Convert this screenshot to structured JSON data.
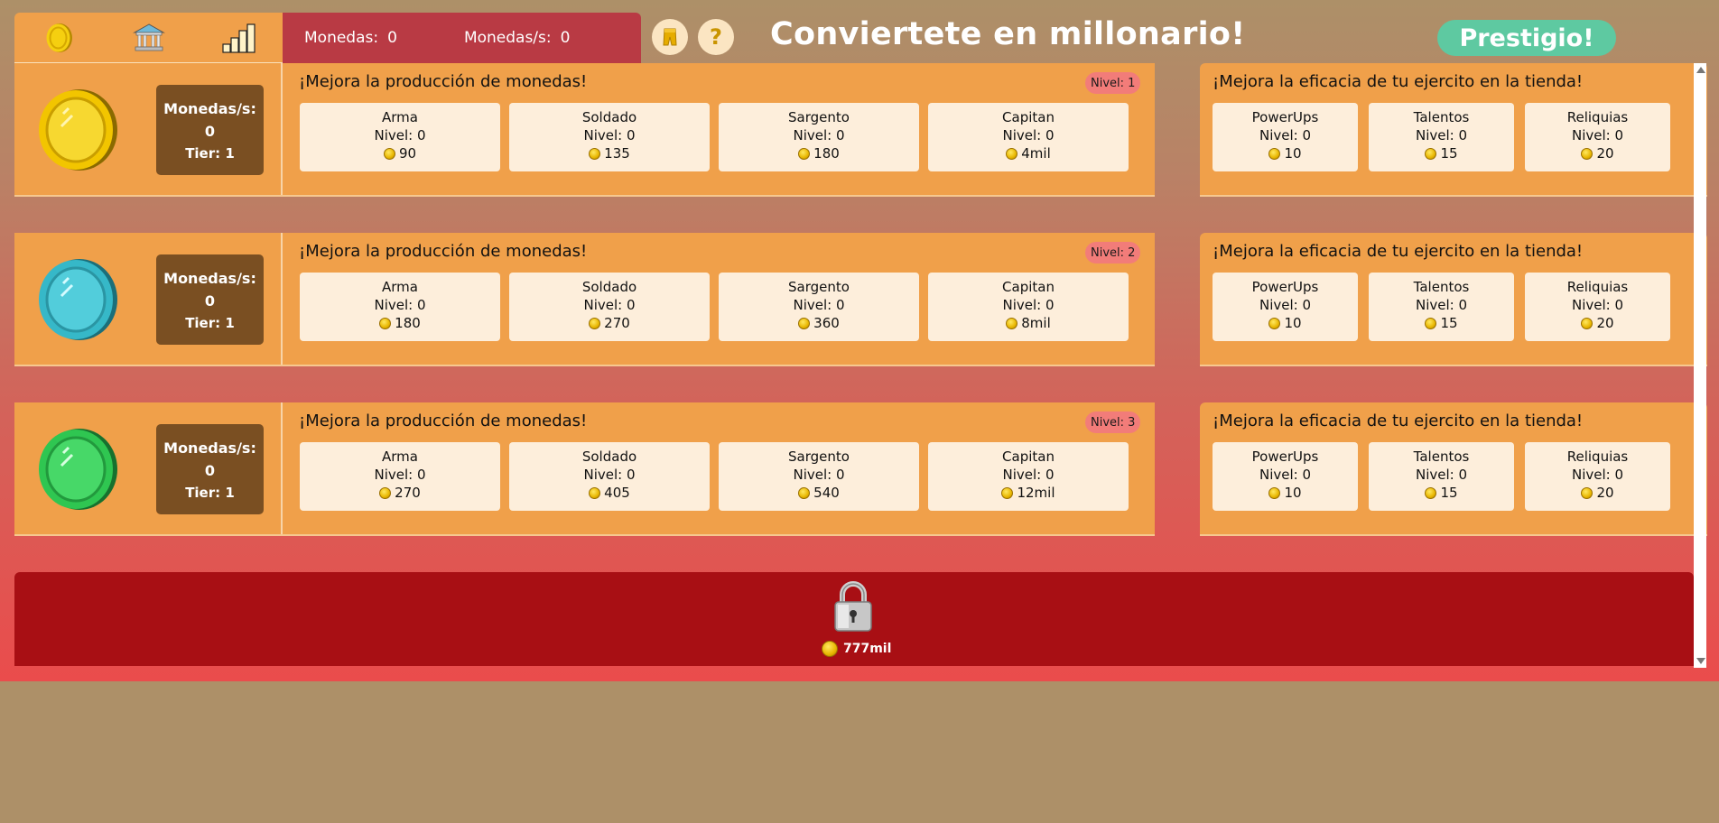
{
  "header": {
    "nav": [
      "coin-icon",
      "bank-icon",
      "bar-chart-icon"
    ],
    "coins_label": "Monedas:",
    "coins_value": "0",
    "rate_label": "Monedas/s:",
    "rate_value": "0",
    "help_symbol": "?",
    "title": "Conviertete en millonario!",
    "prestige_label": "Prestigio!"
  },
  "rows": [
    {
      "coin_color": "#f2c500",
      "rate_label": "Monedas/s:",
      "rate_value": "0",
      "tier": "Tier: 1",
      "upgrade_title": "¡Mejora la producción de monedas!",
      "level": "Nivel: 1",
      "upgrades": [
        {
          "name": "Arma",
          "level": "Nivel: 0",
          "cost": "90"
        },
        {
          "name": "Soldado",
          "level": "Nivel: 0",
          "cost": "135"
        },
        {
          "name": "Sargento",
          "level": "Nivel: 0",
          "cost": "180"
        },
        {
          "name": "Capitan",
          "level": "Nivel: 0",
          "cost": "4mil"
        }
      ],
      "army_title": "¡Mejora la eficacia de tu ejercito en la tienda!",
      "army": [
        {
          "name": "PowerUps",
          "level": "Nivel: 0",
          "cost": "10"
        },
        {
          "name": "Talentos",
          "level": "Nivel: 0",
          "cost": "15"
        },
        {
          "name": "Reliquias",
          "level": "Nivel: 0",
          "cost": "20"
        }
      ]
    },
    {
      "coin_color": "#36b8c8",
      "rate_label": "Monedas/s:",
      "rate_value": "0",
      "tier": "Tier: 1",
      "upgrade_title": "¡Mejora la producción de monedas!",
      "level": "Nivel: 2",
      "upgrades": [
        {
          "name": "Arma",
          "level": "Nivel: 0",
          "cost": "180"
        },
        {
          "name": "Soldado",
          "level": "Nivel: 0",
          "cost": "270"
        },
        {
          "name": "Sargento",
          "level": "Nivel: 0",
          "cost": "360"
        },
        {
          "name": "Capitan",
          "level": "Nivel: 0",
          "cost": "8mil"
        }
      ],
      "army_title": "¡Mejora la eficacia de tu ejercito en la tienda!",
      "army": [
        {
          "name": "PowerUps",
          "level": "Nivel: 0",
          "cost": "10"
        },
        {
          "name": "Talentos",
          "level": "Nivel: 0",
          "cost": "15"
        },
        {
          "name": "Reliquias",
          "level": "Nivel: 0",
          "cost": "20"
        }
      ]
    },
    {
      "coin_color": "#2fc651",
      "rate_label": "Monedas/s:",
      "rate_value": "0",
      "tier": "Tier: 1",
      "upgrade_title": "¡Mejora la producción de monedas!",
      "level": "Nivel: 3",
      "upgrades": [
        {
          "name": "Arma",
          "level": "Nivel: 0",
          "cost": "270"
        },
        {
          "name": "Soldado",
          "level": "Nivel: 0",
          "cost": "405"
        },
        {
          "name": "Sargento",
          "level": "Nivel: 0",
          "cost": "540"
        },
        {
          "name": "Capitan",
          "level": "Nivel: 0",
          "cost": "12mil"
        }
      ],
      "army_title": "¡Mejora la eficacia de tu ejercito en la tienda!",
      "army": [
        {
          "name": "PowerUps",
          "level": "Nivel: 0",
          "cost": "10"
        },
        {
          "name": "Talentos",
          "level": "Nivel: 0",
          "cost": "15"
        },
        {
          "name": "Reliquias",
          "level": "Nivel: 0",
          "cost": "20"
        }
      ]
    }
  ],
  "locked": {
    "icon": "padlock-icon",
    "cost": "777mil"
  },
  "colors": {
    "panel": "#f0a04a",
    "stats_bar": "#b93a44",
    "prestige": "#5ec9a1",
    "locked_bg": "#a80f14",
    "rate_box": "#7a4f22"
  }
}
